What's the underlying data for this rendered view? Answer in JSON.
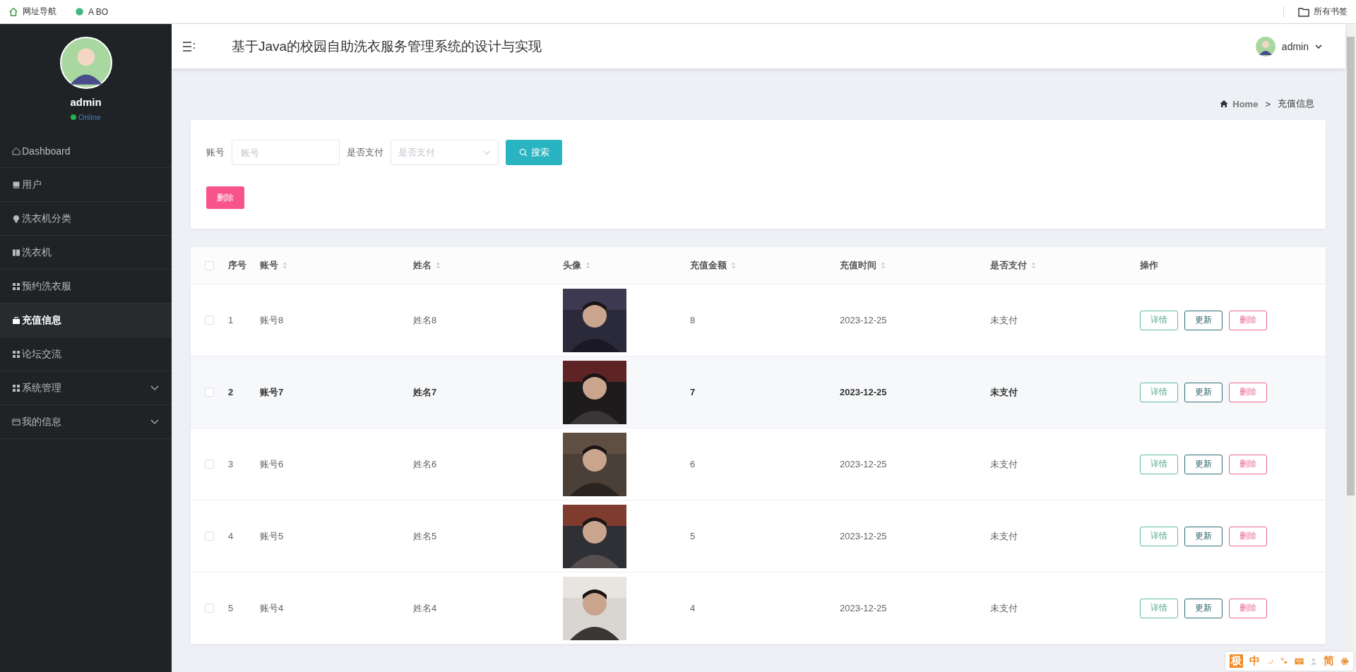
{
  "bookmarks_bar": {
    "items": [
      {
        "label": "网址导航"
      },
      {
        "label": "A BO"
      }
    ],
    "all_bookmarks": "所有书签"
  },
  "sidebar": {
    "user": {
      "name": "admin",
      "status": "Online"
    },
    "items": [
      {
        "label": "Dashboard",
        "selected": false,
        "expandable": false
      },
      {
        "label": "用户",
        "selected": false,
        "expandable": false
      },
      {
        "label": "洗衣机分类",
        "selected": false,
        "expandable": false
      },
      {
        "label": "洗衣机",
        "selected": false,
        "expandable": false
      },
      {
        "label": "预约洗衣服",
        "selected": false,
        "expandable": false
      },
      {
        "label": "充值信息",
        "selected": true,
        "expandable": false
      },
      {
        "label": "论坛交流",
        "selected": false,
        "expandable": false
      },
      {
        "label": "系统管理",
        "selected": false,
        "expandable": true
      },
      {
        "label": "我的信息",
        "selected": false,
        "expandable": true
      }
    ]
  },
  "header": {
    "title": "基于Java的校园自助洗衣服务管理系统的设计与实现",
    "user": "admin"
  },
  "breadcrumb": {
    "home": "Home",
    "separator": ">",
    "current": "充值信息"
  },
  "search": {
    "fields": [
      {
        "label": "账号",
        "kind": "input",
        "placeholder": "账号"
      },
      {
        "label": "是否支付",
        "kind": "select",
        "placeholder": "是否支付"
      }
    ],
    "button": "搜索",
    "delete_button": "删除"
  },
  "table": {
    "select_all": {
      "checked": false
    },
    "columns": [
      {
        "label": "序号",
        "sortable": false
      },
      {
        "label": "账号",
        "sortable": true
      },
      {
        "label": "姓名",
        "sortable": true
      },
      {
        "label": "头像",
        "sortable": true
      },
      {
        "label": "充值金额",
        "sortable": true
      },
      {
        "label": "充值时间",
        "sortable": true
      },
      {
        "label": "是否支付",
        "sortable": true
      },
      {
        "label": "操作",
        "sortable": false
      }
    ],
    "rows": [
      {
        "checked": false,
        "index": "1",
        "account": "账号8",
        "name": "姓名8",
        "amount": "8",
        "time": "2023-12-25",
        "paid": "未支付",
        "highlighted": false,
        "actions": [
          "详情",
          "更新",
          "删除"
        ]
      },
      {
        "checked": false,
        "index": "2",
        "account": "账号7",
        "name": "姓名7",
        "amount": "7",
        "time": "2023-12-25",
        "paid": "未支付",
        "highlighted": true,
        "actions": [
          "详情",
          "更新",
          "删除"
        ]
      },
      {
        "checked": false,
        "index": "3",
        "account": "账号6",
        "name": "姓名6",
        "amount": "6",
        "time": "2023-12-25",
        "paid": "未支付",
        "highlighted": false,
        "actions": [
          "详情",
          "更新",
          "删除"
        ]
      },
      {
        "checked": false,
        "index": "4",
        "account": "账号5",
        "name": "姓名5",
        "amount": "5",
        "time": "2023-12-25",
        "paid": "未支付",
        "highlighted": false,
        "actions": [
          "详情",
          "更新",
          "删除"
        ]
      },
      {
        "checked": false,
        "index": "5",
        "account": "账号4",
        "name": "姓名4",
        "amount": "4",
        "time": "2023-12-25",
        "paid": "未支付",
        "highlighted": false,
        "actions": [
          "详情",
          "更新",
          "删除"
        ]
      }
    ]
  },
  "ime_toolbar": {
    "items": [
      "极",
      "中",
      "简"
    ]
  }
}
